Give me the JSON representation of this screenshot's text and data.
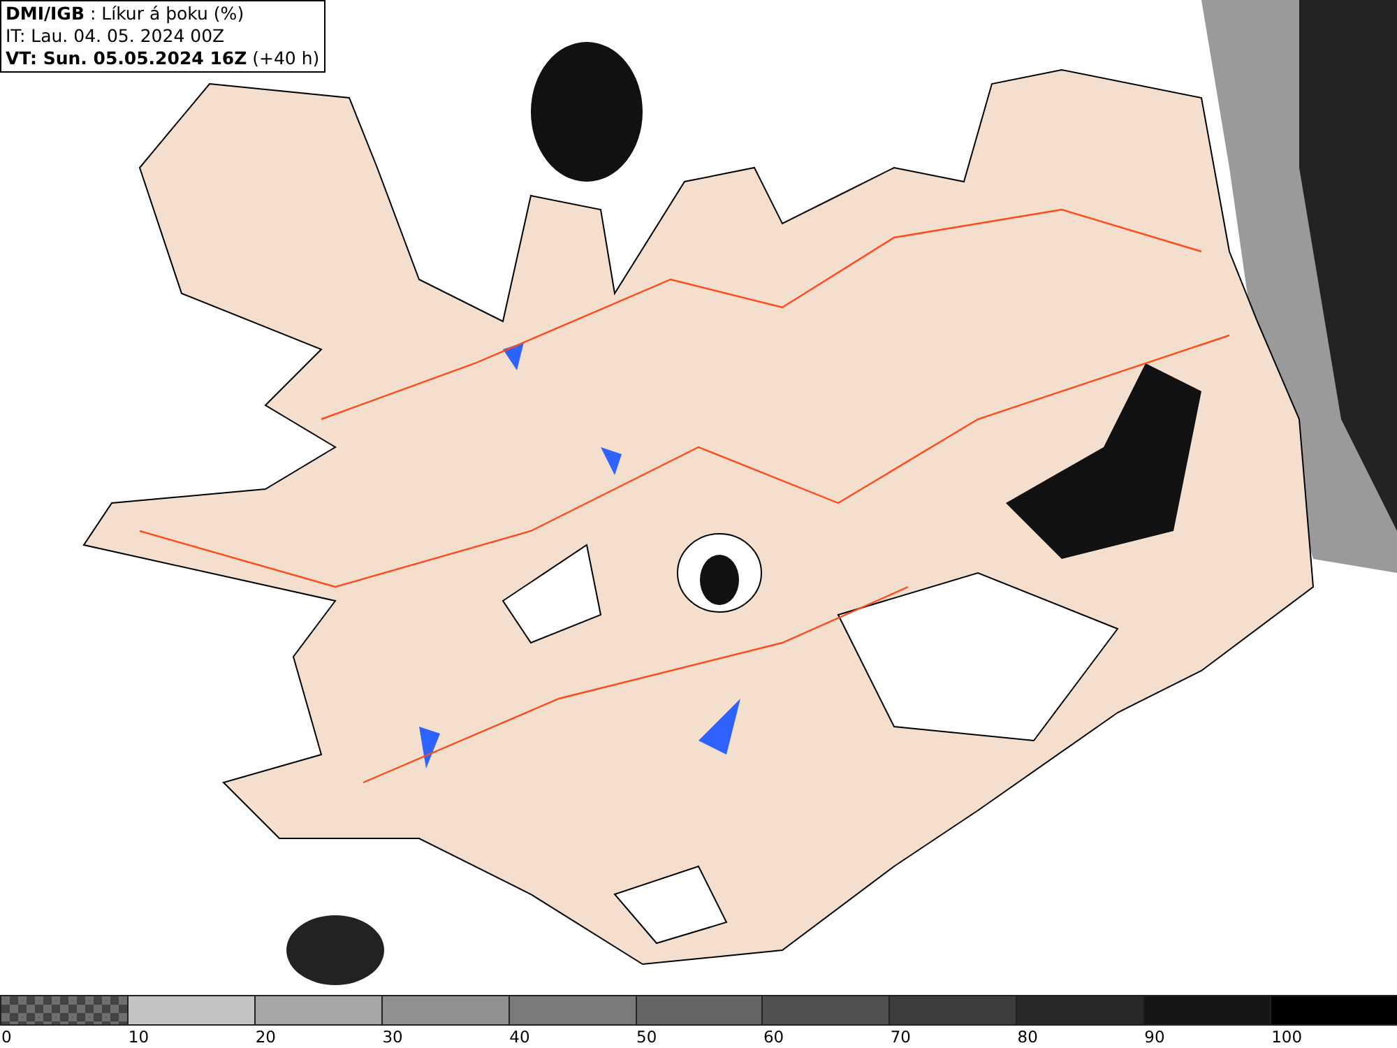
{
  "header": {
    "lines": [
      "**DMI/IGB** : Líkur á þoku (%)",
      "IT: Lau. 04. 05. 2024 00Z",
      "**VT: Sun. 05.05.2024 16Z** (+40 h)"
    ]
  },
  "legend": {
    "bins": [
      {
        "kind": "checker",
        "color": "#6e6e6e",
        "label": "0"
      },
      {
        "kind": "solid",
        "color": "#c4c4c4",
        "label": "10"
      },
      {
        "kind": "solid",
        "color": "#a6a6a6",
        "label": "20"
      },
      {
        "kind": "solid",
        "color": "#909090",
        "label": "30"
      },
      {
        "kind": "solid",
        "color": "#7a7a7a",
        "label": "40"
      },
      {
        "kind": "solid",
        "color": "#646464",
        "label": "50"
      },
      {
        "kind": "solid",
        "color": "#505050",
        "label": "60"
      },
      {
        "kind": "solid",
        "color": "#3c3c3c",
        "label": "70"
      },
      {
        "kind": "solid",
        "color": "#282828",
        "label": "80"
      },
      {
        "kind": "solid",
        "color": "#151515",
        "label": "90"
      },
      {
        "kind": "solid",
        "color": "#000000",
        "label": "100"
      }
    ]
  }
}
